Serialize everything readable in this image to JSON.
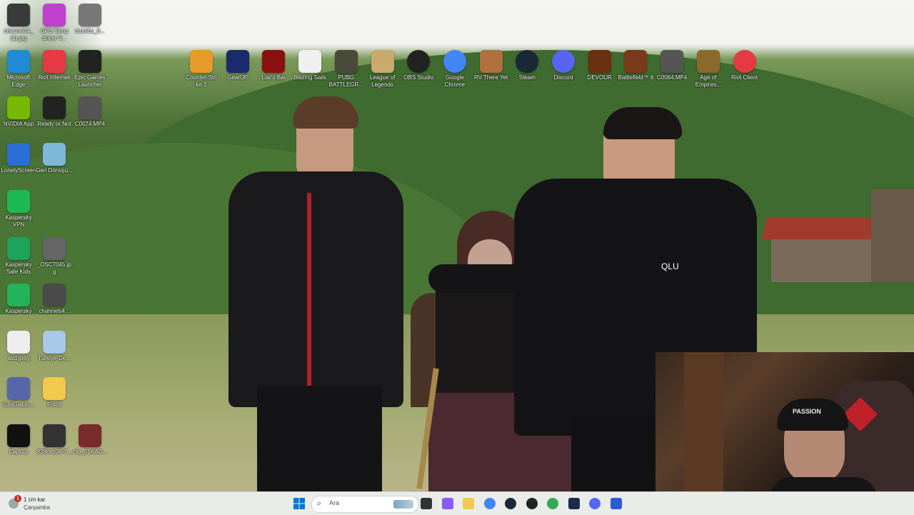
{
  "desktop_icons_left": [
    {
      "label": "channels4_ (1).jpg",
      "icon": "image-thumb-icon",
      "color": "#3a3a3a"
    },
    {
      "label": "GPU Temp driver V...",
      "icon": "gpu-icon",
      "color": "#c040d0"
    },
    {
      "label": "thumbs_0...",
      "icon": "image-thumb-icon",
      "color": "#777777"
    },
    {
      "label": "Microsoft Edge",
      "icon": "edge-icon",
      "color": "#1f8bd6"
    },
    {
      "label": "Riot Interneti",
      "icon": "riot-icon",
      "color": "#e63946"
    },
    {
      "label": "Epic Games Launcher",
      "icon": "epic-icon",
      "color": "#222222"
    },
    {
      "label": "NVIDIA App",
      "icon": "nvidia-icon",
      "color": "#76b900"
    },
    {
      "label": "Ready or Not",
      "icon": "epic-icon",
      "color": "#222222"
    },
    {
      "label": "C0074.MP4",
      "icon": "video-icon",
      "color": "#555555"
    },
    {
      "label": "LonelyScreen",
      "icon": "monitor-icon",
      "color": "#2a6fd6"
    },
    {
      "label": "Geri Dönüşü...",
      "icon": "recycle-bin-icon",
      "color": "#7fb7d8"
    },
    {
      "label": "Kaspersky VPN",
      "icon": "kaspersky-vpn-icon",
      "color": "#1db954"
    },
    {
      "label": "Kaspersky Safe Kids",
      "icon": "kaspersky-kids-icon",
      "color": "#1fa35a"
    },
    {
      "label": "_DSC7045.jpg",
      "icon": "image-thumb-icon",
      "color": "#666666"
    },
    {
      "label": "Kaspersky",
      "icon": "kaspersky-icon",
      "color": "#23b35a"
    },
    {
      "label": "channels4...",
      "icon": "image-thumb-icon",
      "color": "#4a4a4a"
    },
    {
      "label": "asd.jpeg",
      "icon": "image-thumb-icon",
      "color": "#eeeeee"
    },
    {
      "label": "Turkiye-De...",
      "icon": "image-thumb-icon",
      "color": "#a8c8e8"
    },
    {
      "label": "GseGwLin...",
      "icon": "image-thumb-icon",
      "color": "#5566aa"
    },
    {
      "label": "Fotos",
      "icon": "folder-icon",
      "color": "#f2c94c"
    },
    {
      "label": "CapCut",
      "icon": "capcut-icon",
      "color": "#111111"
    },
    {
      "label": "829cec08-7...",
      "icon": "file-icon",
      "color": "#333333"
    },
    {
      "label": "clip_01KAG...",
      "icon": "video-icon",
      "color": "#7a2a2a"
    }
  ],
  "desktop_icons_top": [
    {
      "label": "Counter-Stri ke 2",
      "icon": "cs2-icon",
      "color": "#e59a2a"
    },
    {
      "label": "GearUP",
      "icon": "gearup-icon",
      "color": "#1a2a6a"
    },
    {
      "label": "Liar's Bar",
      "icon": "liars-bar-icon",
      "color": "#8a1010"
    },
    {
      "label": "Blazing Sails",
      "icon": "skull-icon",
      "color": "#f0f0f0"
    },
    {
      "label": "PUBG BATTLEGR...",
      "icon": "pubg-icon",
      "color": "#4a4a3a"
    },
    {
      "label": "League of Legends",
      "icon": "lol-icon",
      "color": "#c8aa6e"
    },
    {
      "label": "OBS Studio",
      "icon": "obs-icon",
      "color": "#222222"
    },
    {
      "label": "Google Chrome",
      "icon": "chrome-icon",
      "color": "#4285f4"
    },
    {
      "label": "RV There Yet",
      "icon": "rv-icon",
      "color": "#b07040"
    },
    {
      "label": "Steam",
      "icon": "steam-icon",
      "color": "#1b2838"
    },
    {
      "label": "Discord",
      "icon": "discord-icon",
      "color": "#5865f2"
    },
    {
      "label": "DEVOUR",
      "icon": "devour-icon",
      "color": "#6a3010"
    },
    {
      "label": "Battlefield™ 6",
      "icon": "battlefield-icon",
      "color": "#7a3a1a"
    },
    {
      "label": "C0064.MP4",
      "icon": "video-icon",
      "color": "#555555"
    },
    {
      "label": "Age of Empires...",
      "icon": "aoe-icon",
      "color": "#8a6a2a"
    },
    {
      "label": "Riot Client",
      "icon": "riot-icon",
      "color": "#e63946"
    }
  ],
  "scene": {
    "hoodie_text": "QLU"
  },
  "taskbar": {
    "weather_temp": "1 cm kar",
    "weather_day": "Çarşamba",
    "weather_badge": "1",
    "search_placeholder": "Ara",
    "apps": [
      {
        "name": "start-button",
        "icon": "windows-icon",
        "color": "#0078d4"
      },
      {
        "name": "task-view",
        "icon": "task-view-icon",
        "color": "#333333"
      },
      {
        "name": "copilot",
        "icon": "copilot-icon",
        "color": "#8a5cf6"
      },
      {
        "name": "file-explorer",
        "icon": "folder-icon",
        "color": "#f2c94c"
      },
      {
        "name": "chrome",
        "icon": "chrome-icon",
        "color": "#4285f4"
      },
      {
        "name": "steam",
        "icon": "steam-icon",
        "color": "#1b2838"
      },
      {
        "name": "obs",
        "icon": "obs-icon",
        "color": "#222222"
      },
      {
        "name": "chrome-profile",
        "icon": "chrome-icon",
        "color": "#34a853"
      },
      {
        "name": "vscode",
        "icon": "vscode-icon",
        "color": "#1e2a4a"
      },
      {
        "name": "discord",
        "icon": "discord-icon",
        "color": "#5865f2"
      },
      {
        "name": "unknown-app",
        "icon": "app-icon",
        "color": "#2a5ad6"
      }
    ]
  },
  "webcam": {
    "cap_text": "PASSION"
  }
}
